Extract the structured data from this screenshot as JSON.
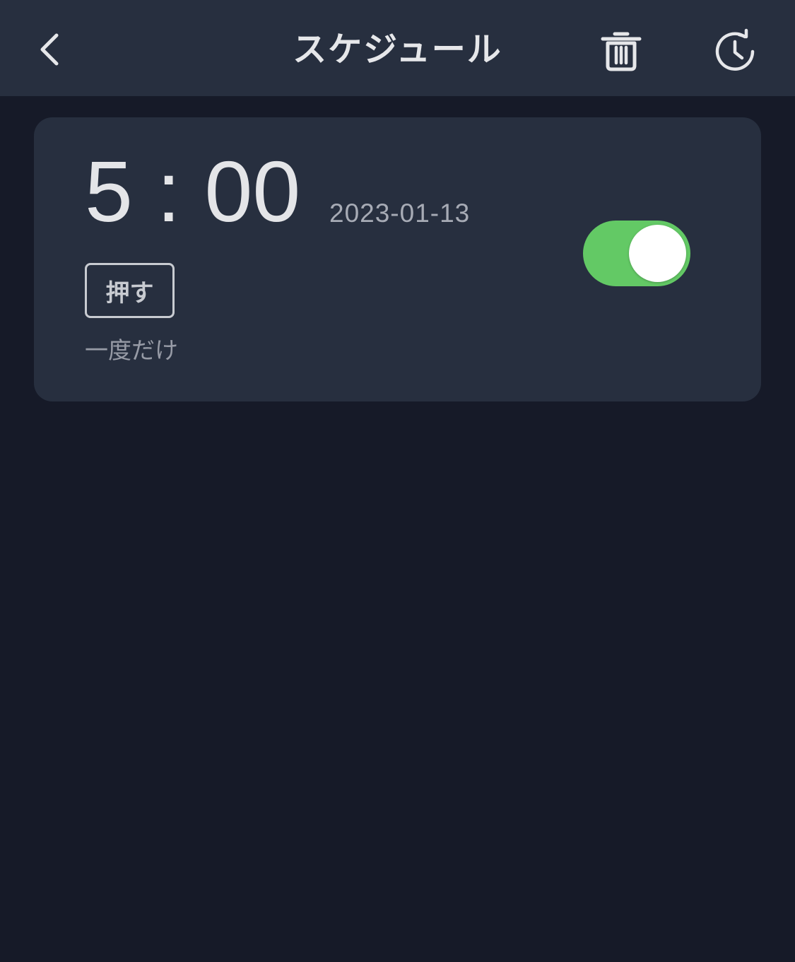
{
  "header": {
    "title": "スケジュール",
    "back_icon": "chevron-left-icon",
    "delete_icon": "trash-icon",
    "history_icon": "clock-history-icon"
  },
  "schedule": {
    "time": "5 : 00",
    "date": "2023-01-13",
    "action": "押す",
    "repeat": "一度だけ",
    "enabled": true,
    "toggle_color": "#63c965"
  },
  "colors": {
    "background": "#161a28",
    "surface": "#272f3f",
    "text": "#e4e5e8"
  }
}
